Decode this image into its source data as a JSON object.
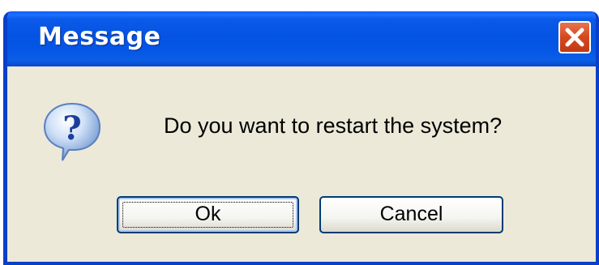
{
  "window": {
    "title": "Message",
    "close_icon": "close-icon"
  },
  "dialog": {
    "icon": "question-icon",
    "message": "Do you want to restart the system?"
  },
  "buttons": {
    "ok_label": "Ok",
    "cancel_label": "Cancel"
  },
  "colors": {
    "titlebar": "#0553e3",
    "body": "#ece9d8",
    "close_button": "#d6481f"
  }
}
